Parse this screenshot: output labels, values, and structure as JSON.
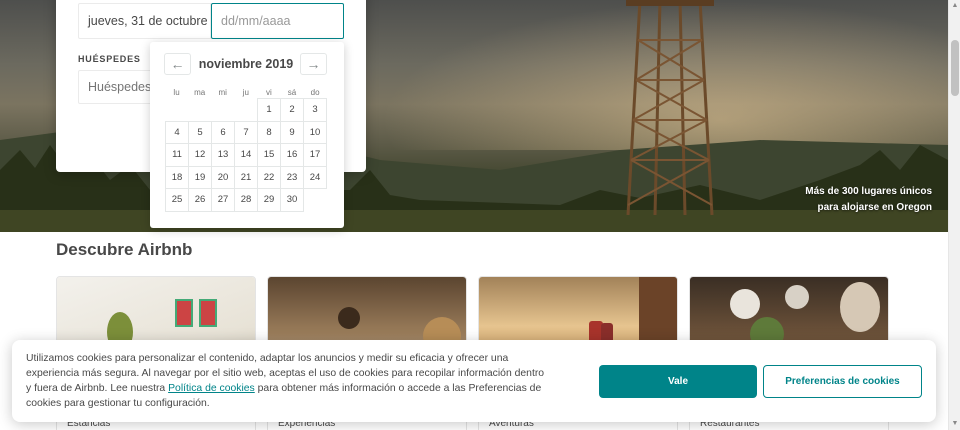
{
  "search": {
    "checkin_value": "jueves, 31 de octubre",
    "checkout_placeholder": "dd/mm/aaaa",
    "guests_label": "HUÉSPEDES",
    "guests_placeholder": "Huéspedes"
  },
  "calendar": {
    "month_title": "noviembre 2019",
    "prev_icon": "←",
    "next_icon": "→",
    "weekdays": [
      "lu",
      "ma",
      "mi",
      "ju",
      "vi",
      "sá",
      "do"
    ],
    "weeks": [
      [
        "",
        "",
        "",
        "",
        "1",
        "2",
        "3"
      ],
      [
        "4",
        "5",
        "6",
        "7",
        "8",
        "9",
        "10"
      ],
      [
        "11",
        "12",
        "13",
        "14",
        "15",
        "16",
        "17"
      ],
      [
        "18",
        "19",
        "20",
        "21",
        "22",
        "23",
        "24"
      ],
      [
        "25",
        "26",
        "27",
        "28",
        "29",
        "30",
        ""
      ]
    ]
  },
  "hero": {
    "caption_line1": "Más de 300 lugares únicos",
    "caption_line2": "para alojarse en Oregon"
  },
  "discover": {
    "title": "Descubre Airbnb",
    "cards": [
      {
        "label": "Estancias"
      },
      {
        "label": "Experiencias"
      },
      {
        "label": "Aventuras"
      },
      {
        "label": "Restaurantes"
      }
    ]
  },
  "cookie": {
    "text_before_link": "Utilizamos cookies para personalizar el contenido, adaptar los anuncios y medir su eficacia y ofrecer una experiencia más segura. Al navegar por el sitio web, aceptas el uso de cookies para recopilar información dentro y fuera de Airbnb. Lee nuestra ",
    "link_text": "Política de cookies",
    "text_after_link": " para obtener más información o accede a las Preferencias de cookies para gestionar tu configuración.",
    "accept_label": "Vale",
    "prefs_label": "Preferencias de cookies"
  },
  "colors": {
    "accent": "#008489",
    "text": "#484848"
  }
}
